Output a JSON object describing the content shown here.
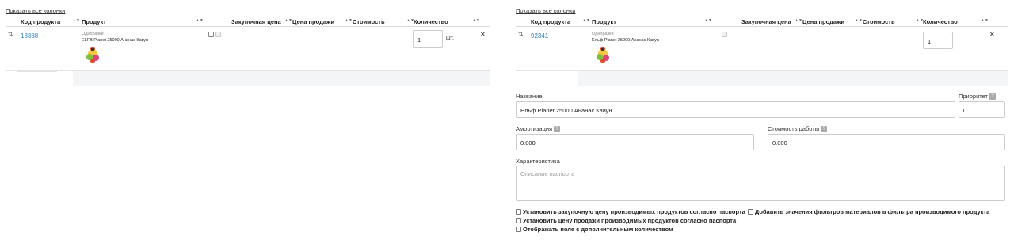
{
  "left": {
    "show_columns": "Показать все колонки",
    "columns": {
      "code": "Код продукта",
      "product": "Продукт",
      "purchase_price": "Закупочная цена",
      "sale_price": "Цена продажи",
      "cost": "Стоимость",
      "quantity": "Количество"
    },
    "row": {
      "code": "18388",
      "category": "Одноразки",
      "name": "ELFB Planet 25000 Ананас Кавун",
      "quantity": "1",
      "unit": "шт."
    }
  },
  "right": {
    "show_columns": "Показать все колонки",
    "columns": {
      "code": "Код продукта",
      "product": "Продукт",
      "purchase_price": "Закупочная цена",
      "sale_price": "Цена продажи",
      "cost": "Стоимость",
      "quantity": "Количество"
    },
    "row": {
      "code": "92341",
      "category": "Одноразки",
      "name": "Ельф Planet 25000 Ананас Кавун",
      "quantity": "1"
    },
    "form": {
      "name_label": "Название",
      "name_value": "Ельф Planet 25000 Ананас Кавун",
      "priority_label": "Приоритет",
      "priority_value": "0",
      "amortization_label": "Амортизация",
      "amortization_value": "0.000",
      "work_cost_label": "Стоимость работы",
      "work_cost_value": "0.000",
      "characteristic_label": "Характеристика",
      "characteristic_placeholder": "Описание паспорта",
      "cb_purchase_price": "Установить закупочную цену производимых продуктов согласно паспорта",
      "cb_filters": "Добавить значения фильтров материалов в фильтра производимого продукта",
      "cb_sale_price": "Установить цену продажи производимых продуктов согласно паспорта",
      "cb_extra_qty": "Отображать поле с дополнительным количеством"
    }
  },
  "icons": {
    "sort": "sort-arrows-icon",
    "drag": "drag-handle-icon",
    "close": "close-icon",
    "help": "help-icon"
  }
}
